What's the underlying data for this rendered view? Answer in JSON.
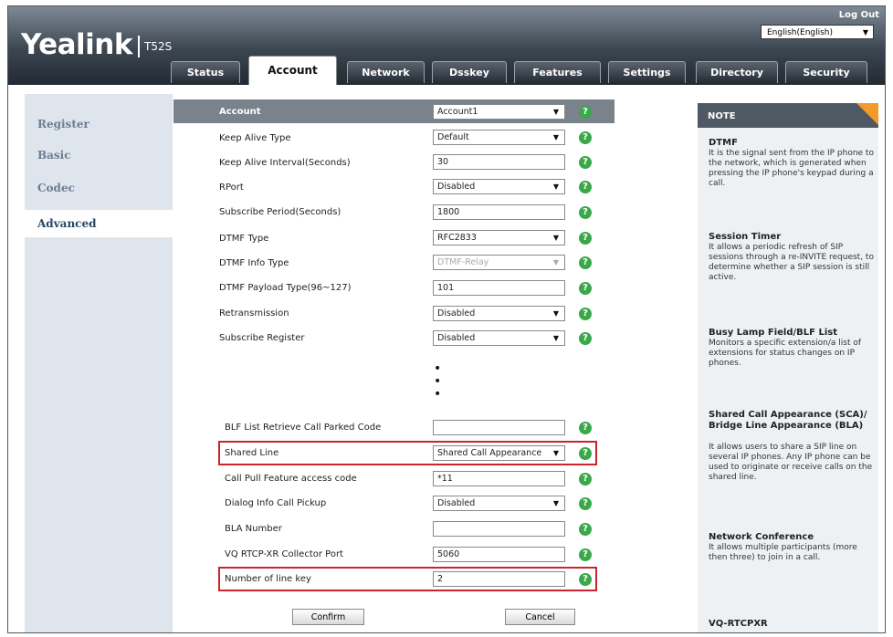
{
  "header": {
    "brand": "Yealink",
    "model": "T52S",
    "logout": "Log Out",
    "language": "English(English)"
  },
  "tabs": [
    {
      "label": "Status"
    },
    {
      "label": "Account"
    },
    {
      "label": "Network"
    },
    {
      "label": "Dsskey"
    },
    {
      "label": "Features"
    },
    {
      "label": "Settings"
    },
    {
      "label": "Directory"
    },
    {
      "label": "Security"
    }
  ],
  "sidebar": {
    "items": [
      {
        "label": "Register"
      },
      {
        "label": "Basic"
      },
      {
        "label": "Codec"
      },
      {
        "label": "Advanced"
      }
    ]
  },
  "form": {
    "rows": [
      {
        "label": "Account",
        "value": "Account1",
        "kind": "select"
      },
      {
        "label": "Keep Alive Type",
        "value": "Default",
        "kind": "select"
      },
      {
        "label": "Keep Alive Interval(Seconds)",
        "value": "30",
        "kind": "text"
      },
      {
        "label": "RPort",
        "value": "Disabled",
        "kind": "select"
      },
      {
        "label": "Subscribe Period(Seconds)",
        "value": "1800",
        "kind": "text"
      },
      {
        "label": "DTMF Type",
        "value": "RFC2833",
        "kind": "select"
      },
      {
        "label": "DTMF Info Type",
        "value": "DTMF-Relay",
        "kind": "select-disabled"
      },
      {
        "label": "DTMF Payload Type(96~127)",
        "value": "101",
        "kind": "text"
      },
      {
        "label": "Retransmission",
        "value": "Disabled",
        "kind": "select"
      },
      {
        "label": "Subscribe Register",
        "value": "Disabled",
        "kind": "select"
      },
      {
        "label": "BLF List Retrieve Call Parked Code",
        "value": "",
        "kind": "text"
      },
      {
        "label": "Shared Line",
        "value": "Shared Call Appearance",
        "kind": "select"
      },
      {
        "label": "Call Pull Feature access code",
        "value": "*11",
        "kind": "text"
      },
      {
        "label": "Dialog Info Call Pickup",
        "value": "Disabled",
        "kind": "select"
      },
      {
        "label": "BLA Number",
        "value": "",
        "kind": "text"
      },
      {
        "label": "VQ RTCP-XR Collector Port",
        "value": "5060",
        "kind": "text"
      },
      {
        "label": "Number of line key",
        "value": "2",
        "kind": "text"
      }
    ],
    "confirm": "Confirm",
    "cancel": "Cancel"
  },
  "note": {
    "heading": "NOTE",
    "sections": [
      {
        "title": "DTMF",
        "text": "It is the signal sent from the IP phone to the network, which is generated when pressing the IP phone's keypad during a call."
      },
      {
        "title": "Session Timer",
        "text": "It allows a periodic refresh of SIP sessions through a re-INVITE request, to determine whether a SIP session is still active."
      },
      {
        "title": "Busy Lamp Field/BLF List",
        "text": "Monitors a specific extension/a list of extensions for status changes on IP phones."
      },
      {
        "title": "Shared Call Appearance (SCA)/ Bridge Line Appearance (BLA)",
        "text": "It allows users to share a SIP line on several IP phones. Any IP phone can be used to originate or receive calls on the shared line."
      },
      {
        "title": "Network Conference",
        "text": "It allows multiple participants (more then three) to join in a call."
      },
      {
        "title": "VQ-RTCPXR",
        "text": ""
      }
    ]
  },
  "colors": {
    "help": "#3aa84a",
    "highlight": "#c8252f",
    "note_corner": "#f39a28"
  }
}
